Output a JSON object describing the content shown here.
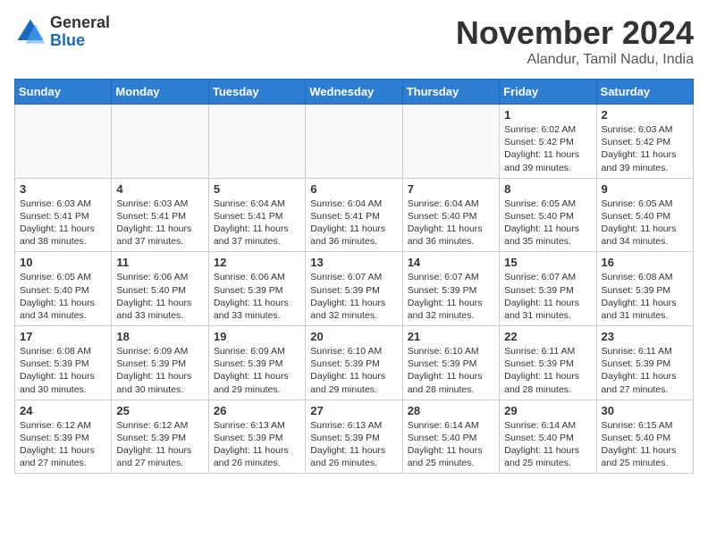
{
  "logo": {
    "general": "General",
    "blue": "Blue"
  },
  "header": {
    "month": "November 2024",
    "location": "Alandur, Tamil Nadu, India"
  },
  "weekdays": [
    "Sunday",
    "Monday",
    "Tuesday",
    "Wednesday",
    "Thursday",
    "Friday",
    "Saturday"
  ],
  "weeks": [
    [
      {
        "day": "",
        "info": ""
      },
      {
        "day": "",
        "info": ""
      },
      {
        "day": "",
        "info": ""
      },
      {
        "day": "",
        "info": ""
      },
      {
        "day": "",
        "info": ""
      },
      {
        "day": "1",
        "info": "Sunrise: 6:02 AM\nSunset: 5:42 PM\nDaylight: 11 hours and 39 minutes."
      },
      {
        "day": "2",
        "info": "Sunrise: 6:03 AM\nSunset: 5:42 PM\nDaylight: 11 hours and 39 minutes."
      }
    ],
    [
      {
        "day": "3",
        "info": "Sunrise: 6:03 AM\nSunset: 5:41 PM\nDaylight: 11 hours and 38 minutes."
      },
      {
        "day": "4",
        "info": "Sunrise: 6:03 AM\nSunset: 5:41 PM\nDaylight: 11 hours and 37 minutes."
      },
      {
        "day": "5",
        "info": "Sunrise: 6:04 AM\nSunset: 5:41 PM\nDaylight: 11 hours and 37 minutes."
      },
      {
        "day": "6",
        "info": "Sunrise: 6:04 AM\nSunset: 5:41 PM\nDaylight: 11 hours and 36 minutes."
      },
      {
        "day": "7",
        "info": "Sunrise: 6:04 AM\nSunset: 5:40 PM\nDaylight: 11 hours and 36 minutes."
      },
      {
        "day": "8",
        "info": "Sunrise: 6:05 AM\nSunset: 5:40 PM\nDaylight: 11 hours and 35 minutes."
      },
      {
        "day": "9",
        "info": "Sunrise: 6:05 AM\nSunset: 5:40 PM\nDaylight: 11 hours and 34 minutes."
      }
    ],
    [
      {
        "day": "10",
        "info": "Sunrise: 6:05 AM\nSunset: 5:40 PM\nDaylight: 11 hours and 34 minutes."
      },
      {
        "day": "11",
        "info": "Sunrise: 6:06 AM\nSunset: 5:40 PM\nDaylight: 11 hours and 33 minutes."
      },
      {
        "day": "12",
        "info": "Sunrise: 6:06 AM\nSunset: 5:39 PM\nDaylight: 11 hours and 33 minutes."
      },
      {
        "day": "13",
        "info": "Sunrise: 6:07 AM\nSunset: 5:39 PM\nDaylight: 11 hours and 32 minutes."
      },
      {
        "day": "14",
        "info": "Sunrise: 6:07 AM\nSunset: 5:39 PM\nDaylight: 11 hours and 32 minutes."
      },
      {
        "day": "15",
        "info": "Sunrise: 6:07 AM\nSunset: 5:39 PM\nDaylight: 11 hours and 31 minutes."
      },
      {
        "day": "16",
        "info": "Sunrise: 6:08 AM\nSunset: 5:39 PM\nDaylight: 11 hours and 31 minutes."
      }
    ],
    [
      {
        "day": "17",
        "info": "Sunrise: 6:08 AM\nSunset: 5:39 PM\nDaylight: 11 hours and 30 minutes."
      },
      {
        "day": "18",
        "info": "Sunrise: 6:09 AM\nSunset: 5:39 PM\nDaylight: 11 hours and 30 minutes."
      },
      {
        "day": "19",
        "info": "Sunrise: 6:09 AM\nSunset: 5:39 PM\nDaylight: 11 hours and 29 minutes."
      },
      {
        "day": "20",
        "info": "Sunrise: 6:10 AM\nSunset: 5:39 PM\nDaylight: 11 hours and 29 minutes."
      },
      {
        "day": "21",
        "info": "Sunrise: 6:10 AM\nSunset: 5:39 PM\nDaylight: 11 hours and 28 minutes."
      },
      {
        "day": "22",
        "info": "Sunrise: 6:11 AM\nSunset: 5:39 PM\nDaylight: 11 hours and 28 minutes."
      },
      {
        "day": "23",
        "info": "Sunrise: 6:11 AM\nSunset: 5:39 PM\nDaylight: 11 hours and 27 minutes."
      }
    ],
    [
      {
        "day": "24",
        "info": "Sunrise: 6:12 AM\nSunset: 5:39 PM\nDaylight: 11 hours and 27 minutes."
      },
      {
        "day": "25",
        "info": "Sunrise: 6:12 AM\nSunset: 5:39 PM\nDaylight: 11 hours and 27 minutes."
      },
      {
        "day": "26",
        "info": "Sunrise: 6:13 AM\nSunset: 5:39 PM\nDaylight: 11 hours and 26 minutes."
      },
      {
        "day": "27",
        "info": "Sunrise: 6:13 AM\nSunset: 5:39 PM\nDaylight: 11 hours and 26 minutes."
      },
      {
        "day": "28",
        "info": "Sunrise: 6:14 AM\nSunset: 5:40 PM\nDaylight: 11 hours and 25 minutes."
      },
      {
        "day": "29",
        "info": "Sunrise: 6:14 AM\nSunset: 5:40 PM\nDaylight: 11 hours and 25 minutes."
      },
      {
        "day": "30",
        "info": "Sunrise: 6:15 AM\nSunset: 5:40 PM\nDaylight: 11 hours and 25 minutes."
      }
    ]
  ]
}
